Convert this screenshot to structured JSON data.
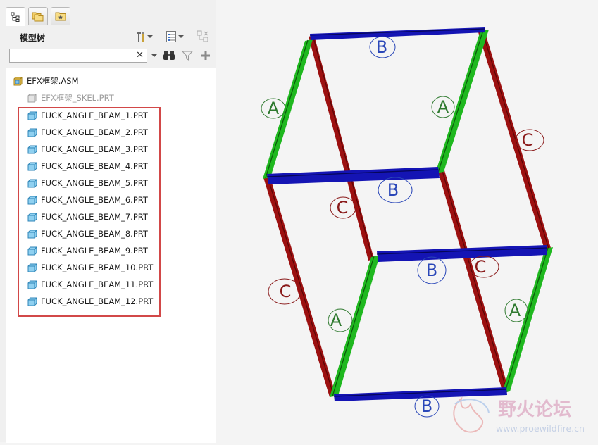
{
  "panel": {
    "title": "模型树",
    "search": {
      "value": "",
      "clear_symbol": "✕"
    }
  },
  "tree": {
    "root": "EFX框架.ASM",
    "skeleton": "EFX框架_SKEL.PRT",
    "parts": [
      "FUCK_ANGLE_BEAM_1.PRT",
      "FUCK_ANGLE_BEAM_2.PRT",
      "FUCK_ANGLE_BEAM_3.PRT",
      "FUCK_ANGLE_BEAM_4.PRT",
      "FUCK_ANGLE_BEAM_5.PRT",
      "FUCK_ANGLE_BEAM_6.PRT",
      "FUCK_ANGLE_BEAM_7.PRT",
      "FUCK_ANGLE_BEAM_8.PRT",
      "FUCK_ANGLE_BEAM_9.PRT",
      "FUCK_ANGLE_BEAM_10.PRT",
      "FUCK_ANGLE_BEAM_11.PRT",
      "FUCK_ANGLE_BEAM_12.PRT"
    ]
  },
  "model": {
    "label_a": "A",
    "label_b": "B",
    "label_c": "C",
    "colors": {
      "a": "#1fb81f",
      "b": "#1414b4",
      "c": "#9c1010"
    }
  },
  "watermark": {
    "title": "野火论坛",
    "url": "www.proewildfire.cn"
  }
}
